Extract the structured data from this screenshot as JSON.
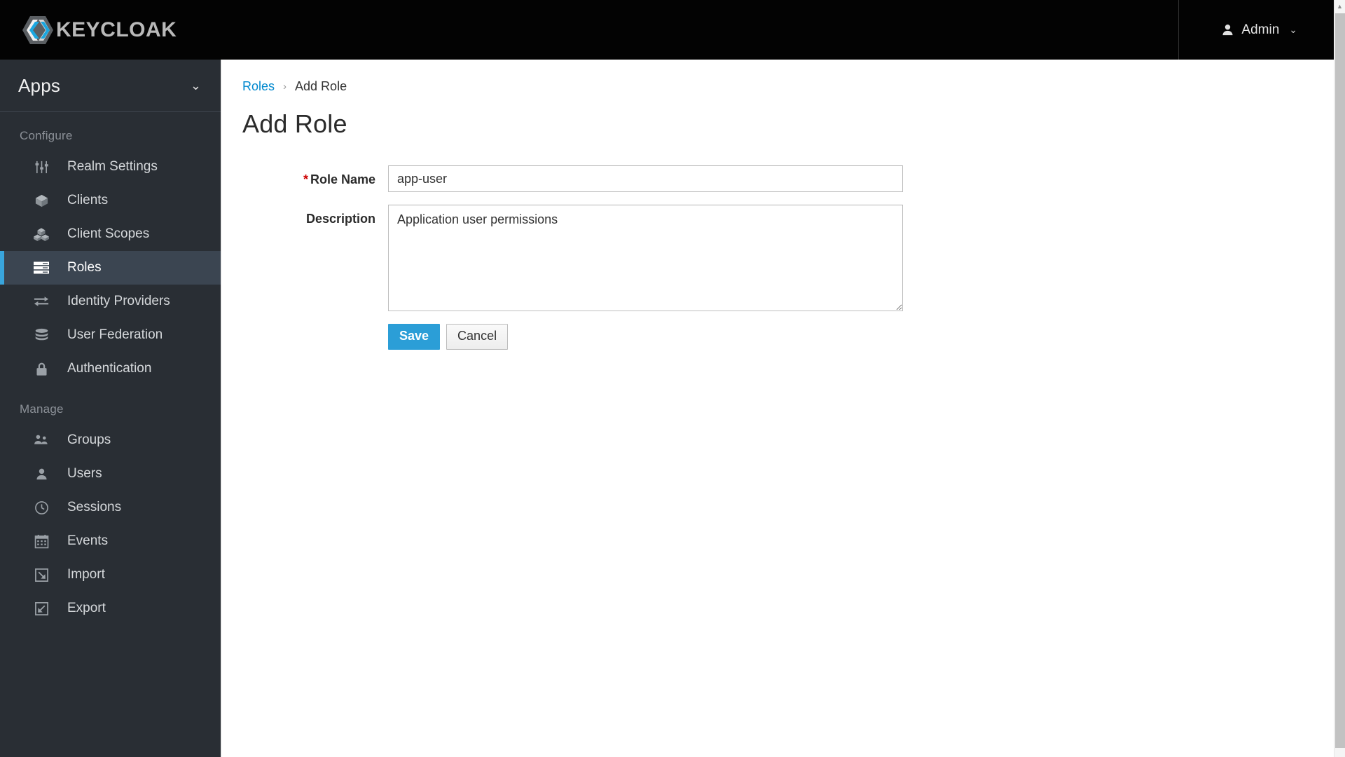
{
  "masthead": {
    "brand_text": "KEYCLOAK",
    "brand_icon": "keycloak-hexagon-logo",
    "user_icon": "user-icon",
    "user_label": "Admin",
    "caret_icon": "chevron-down-icon",
    "caret_glyph": "⌄"
  },
  "sidebar": {
    "realm_label": "Apps",
    "realm_caret_icon": "chevron-down-icon",
    "realm_caret_glyph": "⌄",
    "sections": [
      {
        "label": "Configure",
        "items": [
          {
            "label": "Realm Settings",
            "icon": "sliders-icon",
            "active": false
          },
          {
            "label": "Clients",
            "icon": "cube-icon",
            "active": false
          },
          {
            "label": "Client Scopes",
            "icon": "cubes-icon",
            "active": false
          },
          {
            "label": "Roles",
            "icon": "server-stack-icon",
            "active": true
          },
          {
            "label": "Identity Providers",
            "icon": "exchange-arrows-icon",
            "active": false
          },
          {
            "label": "User Federation",
            "icon": "database-icon",
            "active": false
          },
          {
            "label": "Authentication",
            "icon": "lock-icon",
            "active": false
          }
        ]
      },
      {
        "label": "Manage",
        "items": [
          {
            "label": "Groups",
            "icon": "users-group-icon",
            "active": false
          },
          {
            "label": "Users",
            "icon": "user-icon",
            "active": false
          },
          {
            "label": "Sessions",
            "icon": "clock-icon",
            "active": false
          },
          {
            "label": "Events",
            "icon": "calendar-icon",
            "active": false
          },
          {
            "label": "Import",
            "icon": "import-arrow-icon",
            "active": false
          },
          {
            "label": "Export",
            "icon": "export-arrow-icon",
            "active": false
          }
        ]
      }
    ]
  },
  "breadcrumb": {
    "parent": "Roles",
    "separator": "›",
    "current": "Add Role"
  },
  "page": {
    "title": "Add Role"
  },
  "form": {
    "role_name": {
      "label": "Role Name",
      "required_marker": "*",
      "value": "app-user",
      "placeholder": ""
    },
    "description": {
      "label": "Description",
      "value": "Application user permissions",
      "placeholder": ""
    },
    "save_label": "Save",
    "cancel_label": "Cancel"
  },
  "colors": {
    "accent_blue": "#39a5dc",
    "link_blue": "#0088ce",
    "primary_button": "#2b9ed7",
    "required_red": "#cc0000",
    "sidebar_bg": "#292e34",
    "sidebar_active_bg": "#3b4551",
    "masthead_bg": "#030303"
  },
  "scrollbar": {
    "up_arrow_icon": "scroll-up-arrow-icon",
    "up_arrow_glyph": "▲"
  }
}
